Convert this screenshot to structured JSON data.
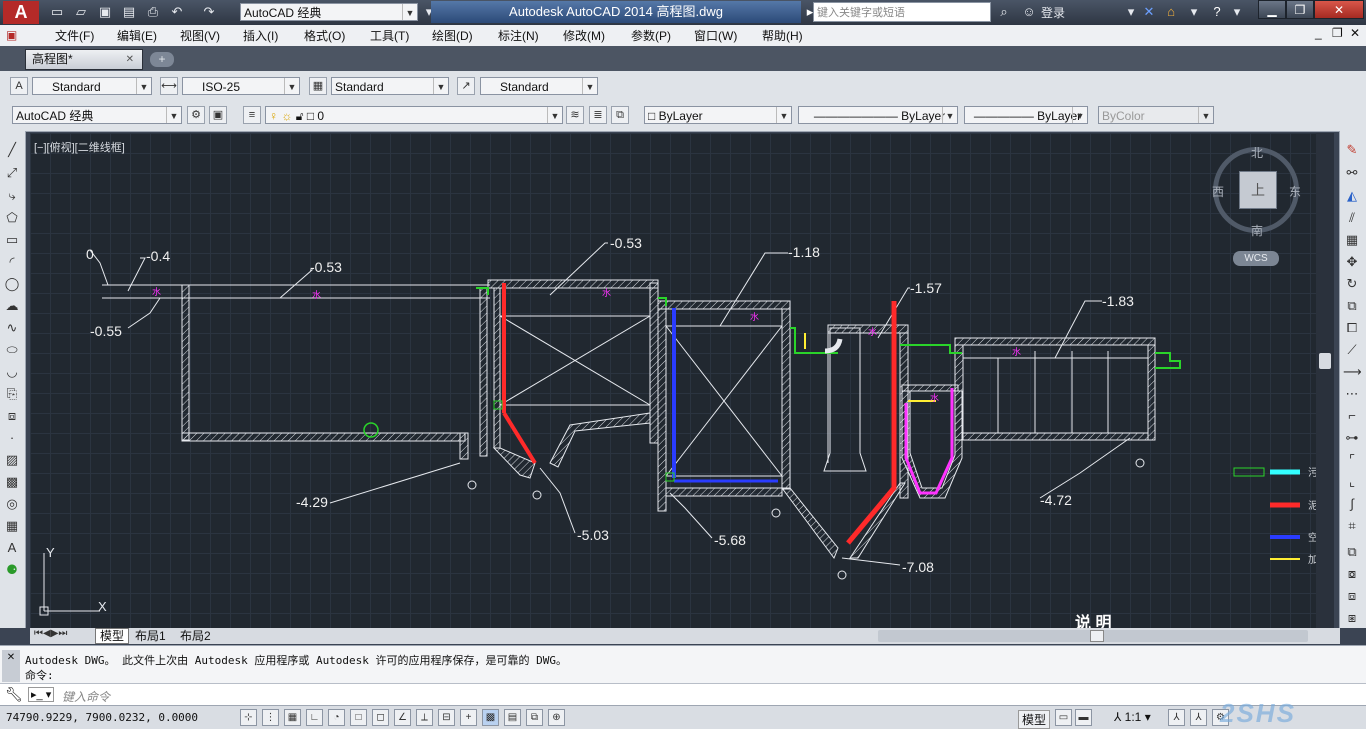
{
  "app": {
    "logo": "A",
    "title": "Autodesk AutoCAD 2014    高程图.dwg",
    "workspace": "AutoCAD 经典",
    "search_placeholder": "键入关键字或短语",
    "login": "登录"
  },
  "menu": [
    "文件(F)",
    "编辑(E)",
    "视图(V)",
    "插入(I)",
    "格式(O)",
    "工具(T)",
    "绘图(D)",
    "标注(N)",
    "修改(M)",
    "参数(P)",
    "窗口(W)",
    "帮助(H)"
  ],
  "doc_tab": {
    "name": "高程图*",
    "close": "✕"
  },
  "styles_toolbar": {
    "text_style": "Standard",
    "dim_style": "ISO-25",
    "table_style": "Standard",
    "mleader_style": "Standard"
  },
  "workspace_toolbar": {
    "workspace": "AutoCAD 经典"
  },
  "layer_toolbar": {
    "layer": "0"
  },
  "properties_toolbar": {
    "color": "ByLayer",
    "linetype": "ByLayer",
    "lineweight": "ByLayer",
    "plotstyle": "ByColor"
  },
  "viewport": {
    "label": "[−][俯视][二维线框]"
  },
  "viewcube": {
    "north": "北",
    "south": "南",
    "east": "东",
    "west": "西",
    "top": "上",
    "wcs": "WCS"
  },
  "drawing": {
    "elevations": [
      "0",
      "-0.4",
      "-0.53",
      "-0.55",
      "-0.53",
      "-1.18",
      "-1.57",
      "-1.83",
      "-4.29",
      "-5.03",
      "-5.68",
      "-7.08",
      "-4.72"
    ],
    "legend_labels": [
      "污",
      "泥",
      "空",
      "加"
    ],
    "water_mark": "水",
    "note": "说 明"
  },
  "layout_tabs": [
    "模型",
    "布局1",
    "布局2"
  ],
  "command": {
    "history_1": "Autodesk DWG。  此文件上次由 Autodesk 应用程序或 Autodesk 许可的应用程序保存，是可靠的 DWG。",
    "history_2": "命令:",
    "placeholder": "键入命令"
  },
  "status": {
    "coords": "74790.9229, 7900.0232, 0.0000",
    "model": "模型",
    "scale": "1:1"
  },
  "watermark": "2SHS"
}
